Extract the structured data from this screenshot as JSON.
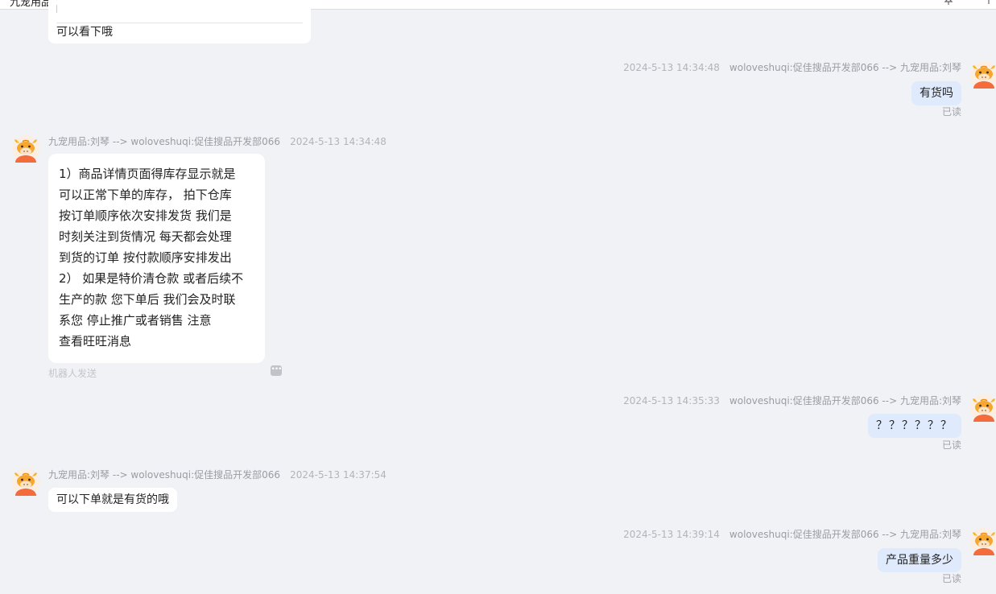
{
  "window": {
    "title": "九宠用品"
  },
  "icons": {
    "avatar": "cow-avatar-icon",
    "more": "more-dots-icon",
    "pin": "pin-icon",
    "menu": "menu-icon"
  },
  "colors": {
    "background": "#f1f2f6",
    "incoming_bubble": "#ffffff",
    "outgoing_bubble": "#dfeafd",
    "meta_text": "#9a9ca3",
    "avatar_orange": "#f46b3c"
  },
  "messages": [
    {
      "direction": "in",
      "text": "可以看下哦"
    },
    {
      "direction": "out",
      "time": "2024-5-13 14:34:48",
      "route": "woloveshuqi:促佳搜品开发部066 --> 九宠用品:刘琴",
      "text": "有货吗",
      "status": "已读"
    },
    {
      "direction": "in",
      "route": "九宠用品:刘琴 --> woloveshuqi:促佳搜品开发部066",
      "time": "2024-5-13 14:34:48",
      "lines": [
        "1）商品详情页面得库存显示就是",
        "可以正常下单的库存， 拍下仓库",
        "按订单顺序依次安排发货     我们是",
        "时刻关注到货情况  每天都会处理",
        "到货的订单 按付款顺序安排发出",
        "2）  如果是特价清仓款 或者后续不",
        "生产的款  您下单后 我们会及时联",
        "系您     停止推广或者销售     注意",
        "查看旺旺消息"
      ],
      "footer": "机器人发送"
    },
    {
      "direction": "out",
      "time": "2024-5-13 14:35:33",
      "route": "woloveshuqi:促佳搜品开发部066 --> 九宠用品:刘琴",
      "text": "？？？？？？",
      "status": "已读"
    },
    {
      "direction": "in",
      "route": "九宠用品:刘琴 --> woloveshuqi:促佳搜品开发部066",
      "time": "2024-5-13 14:37:54",
      "text": "可以下单就是有货的哦"
    },
    {
      "direction": "out",
      "time": "2024-5-13 14:39:14",
      "route": "woloveshuqi:促佳搜品开发部066 --> 九宠用品:刘琴",
      "text": "产品重量多少",
      "status": "已读"
    }
  ]
}
